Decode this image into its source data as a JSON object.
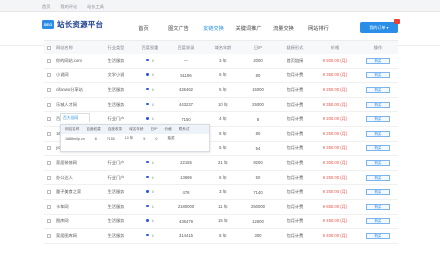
{
  "topbar": {
    "links": [
      "首页",
      "我的评论",
      "站长工具"
    ]
  },
  "logo": {
    "mark": "SEO",
    "name": "站长资源平台",
    "sub": ""
  },
  "nav": [
    "首页",
    "图文广告",
    "友链交换",
    "关键词推广",
    "流量交换",
    "网站排行"
  ],
  "nav_active_index": 2,
  "cart_label": "我的订单 ▾",
  "headers": [
    "网站名称",
    "行业类型",
    "百度权重",
    "百度收录",
    "域名年龄",
    "日IP",
    "链接形式",
    "价格",
    "操作"
  ],
  "rows": [
    {
      "name": "你的网站.com",
      "type": "生活服务",
      "weight_rank": "8",
      "incl": "—",
      "age": "3 年",
      "pv": "2000",
      "form": "首页链接",
      "price": "¥ 500.00 (月)",
      "op": "购买"
    },
    {
      "name": "小说网",
      "type": "文学小说",
      "weight_rank": "8",
      "incl": "51196",
      "age": "5 年",
      "pv": "80",
      "form": "包月计费",
      "price": "¥ 350.00 (月)",
      "op": "购买"
    },
    {
      "name": "cifanwo分享站",
      "type": "生活服务",
      "weight_rank": "8",
      "incl": "426462",
      "age": "5 年",
      "pv": "15000",
      "form": "包月计费",
      "price": "¥ 250.00 (月)",
      "op": "购买"
    },
    {
      "name": "乐城人才网",
      "type": "生活服务",
      "weight_rank": "6",
      "incl": "443237",
      "age": "10 年",
      "pv": "25000",
      "form": "包月计费",
      "price": "¥ 350.00 (月)",
      "op": "购买"
    },
    {
      "name": "百优網络科技",
      "type": "行业门户",
      "weight_rank": "6",
      "incl": "7150",
      "age": "4 年",
      "pv": "8",
      "form": "包月计费",
      "price": "¥ 200.00 (月)",
      "op": "购买"
    },
    {
      "name": "1688m0p.cn",
      "type": "综合门户",
      "weight_rank": "8",
      "incl": "106",
      "age": "8 年",
      "pv": "80",
      "form": "包月计费",
      "price": "¥ 250.00 (月)",
      "op": "购买"
    },
    {
      "name": "youkubo论坛网",
      "type": "论坛社区",
      "weight_rank": "8",
      "incl": "20",
      "age": "5 年",
      "pv": "54",
      "form": "包月计费",
      "price": "¥ 250.00 (月)",
      "op": "购买"
    },
    {
      "name": "家居装修网",
      "type": "行业门户",
      "weight_rank": "6",
      "incl": "22155",
      "age": "21 年",
      "pv": "9200",
      "form": "包月计费",
      "price": "¥ 300.00 (月)",
      "op": "购买"
    },
    {
      "name": "办公达人",
      "type": "行业门户",
      "weight_rank": "6",
      "incl": "13696",
      "age": "6 年",
      "pv": "50",
      "form": "包月计费",
      "price": "¥ 250.00 (月)",
      "op": "购买"
    },
    {
      "name": "量子美食之家",
      "type": "生活服务",
      "weight_rank": "8",
      "incl": "478",
      "age": "3 年",
      "pv": "7140",
      "form": "包月计费",
      "price": "¥ 250.00 (月)",
      "op": "购买"
    },
    {
      "name": "卡车网",
      "type": "生活服务",
      "weight_rank": "6",
      "incl": "2180000",
      "age": "11 年",
      "pv": "250000",
      "form": "包月计费",
      "price": "¥ 650.00 (月)",
      "op": "购买"
    },
    {
      "name": "图库网",
      "type": "生活服务",
      "weight_rank": "6",
      "incl": "436479",
      "age": "15 年",
      "pv": "12600",
      "form": "包月计费",
      "price": "¥ 450.00 (月)",
      "op": "购买"
    },
    {
      "name": "家居图库网",
      "type": "生活服务",
      "weight_rank": "6",
      "incl": "314415",
      "age": "8 年",
      "pv": "300",
      "form": "包月计费",
      "price": "¥ 400.00 (月)",
      "op": "购买"
    }
  ],
  "hover": {
    "tab": "百大佳网",
    "headers": [
      "网站名称",
      "百度权重",
      "百度收录",
      "域名年龄",
      "日IP",
      "价格",
      "联系试"
    ],
    "values": [
      "1688m0p.cn",
      "8",
      "7150",
      "10 年",
      "5",
      "0",
      "抽奖"
    ]
  }
}
